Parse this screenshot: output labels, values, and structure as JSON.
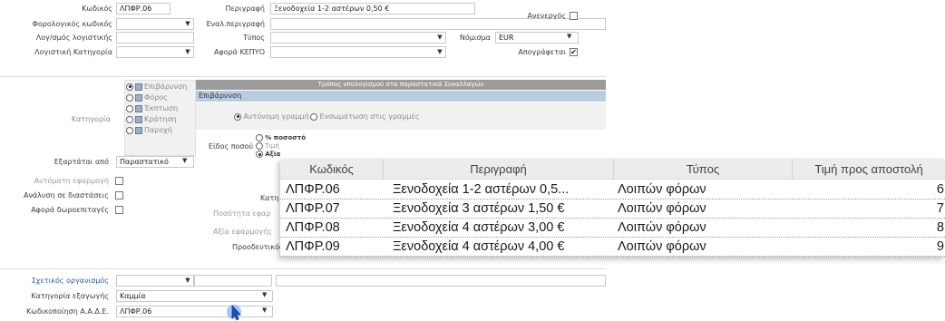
{
  "form": {
    "code_label": "Κωδικός",
    "code_value": "ΛΠΦΡ.06",
    "tax_code_label": "Φορολογικός κωδικός",
    "accounting_label": "Λογ/σμός λογιστικής",
    "accounting_category_label": "Λογιστική Κατηγορία",
    "description_label": "Περιγραφή",
    "description_value": "Ξενοδοχεία 1-2 αστέρων 0,50 €",
    "alt_description_label": "Εναλ.περιγραφή",
    "type_label": "Τύπος",
    "kepyo_label": "Αφορά ΚΕΠΥΟ",
    "inactive_label": "Ανενεργός",
    "currency_label": "Νόμισμα",
    "currency_value": "EUR",
    "deducted_label": "Απογράφεται",
    "deducted_checked": "✔"
  },
  "category": {
    "label": "Κατηγορία",
    "options": [
      {
        "label": "Επιβάρυνση",
        "selected": true
      },
      {
        "label": "Φόρος",
        "selected": false
      },
      {
        "label": "Έκπτωση",
        "selected": false
      },
      {
        "label": "Κράτηση",
        "selected": false
      },
      {
        "label": "Παροχή",
        "selected": false
      }
    ]
  },
  "calc": {
    "header": "Τρόπος υπολογισμού στα παραστατικά Συναλλαγών",
    "selected_row": "Επιβάρυνση",
    "option_autonomous": "Αυτόνομη γραμμή",
    "option_embedded": "Ενσωμάτωση στις γραμμές",
    "amount_type_label": "Είδος ποσού",
    "amount_percent": "% ποσοστό",
    "amount_price": "Τιμή",
    "amount_value": "Αξία"
  },
  "depends": {
    "label": "Εξαρτάται από",
    "value": "Παραστατικό"
  },
  "misc": {
    "auto_apply_label": "Αυτόματη εφαρμογή",
    "analysis_label": "Ανάλυση σε διαστάσεις",
    "gift_label": "Αφορά δωροεπιταγές",
    "kati_label": "Κατη",
    "qty_label": "Ποσότητα εφαρ",
    "value_apply_label": "Αξία εφαρμογής",
    "progressive_label": "Προοδευτικός υ",
    "related_org_label": "Σχετικός οργανισμός",
    "export_category_label": "Κατηγορία εξαγωγής",
    "export_category_value": "Καμμία",
    "aade_label": "Κωδικοποίηση Α.Α.Δ.Ε.",
    "aade_value": "ΛΠΦΡ.06"
  },
  "popup": {
    "headers": [
      "Κωδικός",
      "Περιγραφή",
      "Τύπος",
      "Τιμή προς αποστολή"
    ],
    "rows": [
      {
        "code": "ΛΠΦΡ.06",
        "desc": "Ξενοδοχεία 1-2 αστέρων 0,5...",
        "type": "Λοιπών φόρων",
        "price": "6"
      },
      {
        "code": "ΛΠΦΡ.07",
        "desc": "Ξενοδοχεία 3 αστέρων 1,50 €",
        "type": "Λοιπών φόρων",
        "price": "7"
      },
      {
        "code": "ΛΠΦΡ.08",
        "desc": "Ξενοδοχεία 4 αστέρων 3,00 €",
        "type": "Λοιπών φόρων",
        "price": "8"
      },
      {
        "code": "ΛΠΦΡ.09",
        "desc": "Ξενοδοχεία 4 αστέρων 4,00 €",
        "type": "Λοιπών φόρων",
        "price": "9"
      }
    ]
  }
}
